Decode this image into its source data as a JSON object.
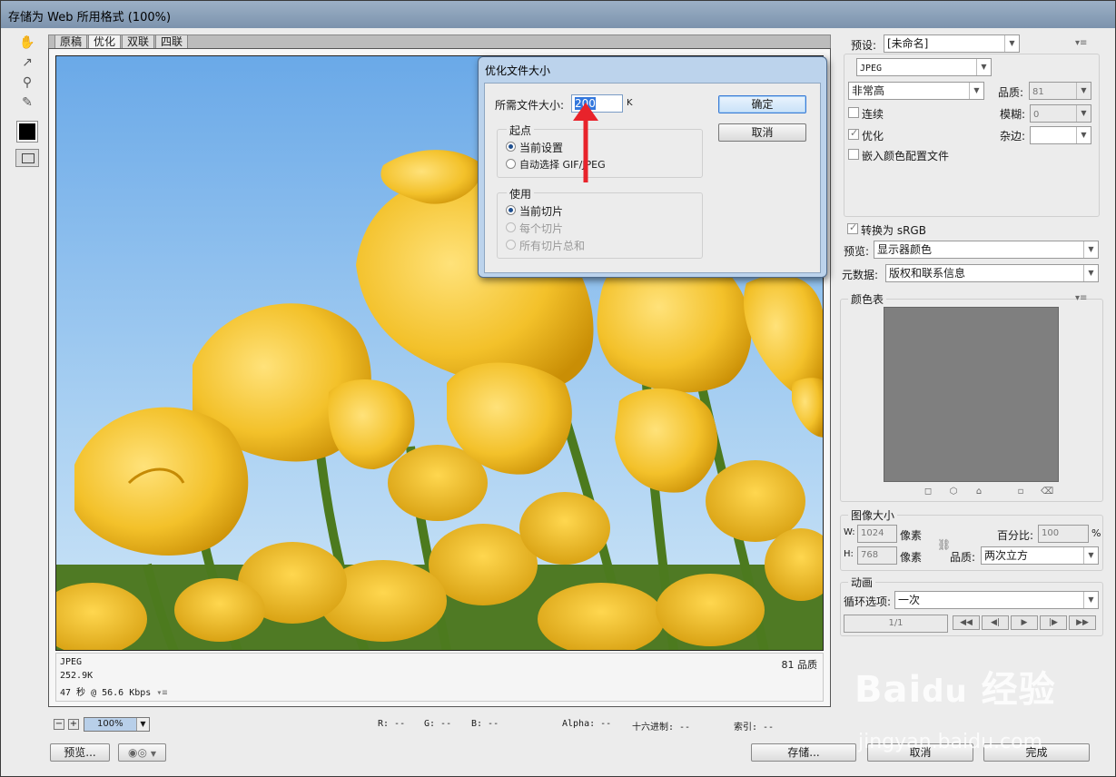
{
  "window": {
    "title": "存储为 Web 所用格式 (100%)"
  },
  "tabs": [
    "原稿",
    "优化",
    "双联",
    "四联"
  ],
  "image_info": {
    "format": "JPEG",
    "size": "252.9K",
    "download": "47 秒 @ 56.6 Kbps",
    "quality": "81 品质"
  },
  "status": {
    "zoom": "100%",
    "r": "R: --",
    "g": "G: --",
    "b": "B: --",
    "alpha": "Alpha: --",
    "hex": "十六进制: --",
    "index": "索引: --"
  },
  "buttons": {
    "preview": "预览...",
    "save": "存储...",
    "cancel": "取消",
    "done": "完成"
  },
  "settings": {
    "preset_label": "预设:",
    "preset_value": "[未命名]",
    "format_value": "JPEG",
    "quality_preset": "非常高",
    "quality_label": "品质:",
    "quality_value": "81",
    "progressive_label": "连续",
    "blur_label": "模糊:",
    "blur_value": "0",
    "optimized_label": "优化",
    "matte_label": "杂边:",
    "embed_profile_label": "嵌入颜色配置文件",
    "convert_srgb_label": "转换为 sRGB",
    "preview_label": "预览:",
    "preview_value": "显示器颜色",
    "metadata_label": "元数据:",
    "metadata_value": "版权和联系信息"
  },
  "color_table": {
    "title": "颜色表"
  },
  "image_size": {
    "title": "图像大小",
    "w_label": "W:",
    "w_value": "1024",
    "h_label": "H:",
    "h_value": "768",
    "unit": "像素",
    "percent_label": "百分比:",
    "percent_value": "100",
    "percent_unit": "%",
    "quality_label": "品质:",
    "quality_value": "两次立方"
  },
  "animation": {
    "title": "动画",
    "loop_label": "循环选项:",
    "loop_value": "一次",
    "frame": "1/1"
  },
  "dialog": {
    "title": "优化文件大小",
    "size_label": "所需文件大小:",
    "size_value": "200",
    "size_unit": "K",
    "ok": "确定",
    "cancel": "取消",
    "start_group": "起点",
    "start_current": "当前设置",
    "start_auto": "自动选择 GIF/JPEG",
    "use_group": "使用",
    "use_current_slice": "当前切片",
    "use_each_slice": "每个切片",
    "use_total": "所有切片总和"
  },
  "watermark": {
    "brand": "Baidu经验",
    "url": "jingyan.baidu.com"
  },
  "colors": {
    "dialog_title": "#bcd3ec",
    "arrow": "#e8232b",
    "highlight": "#3377dd"
  }
}
